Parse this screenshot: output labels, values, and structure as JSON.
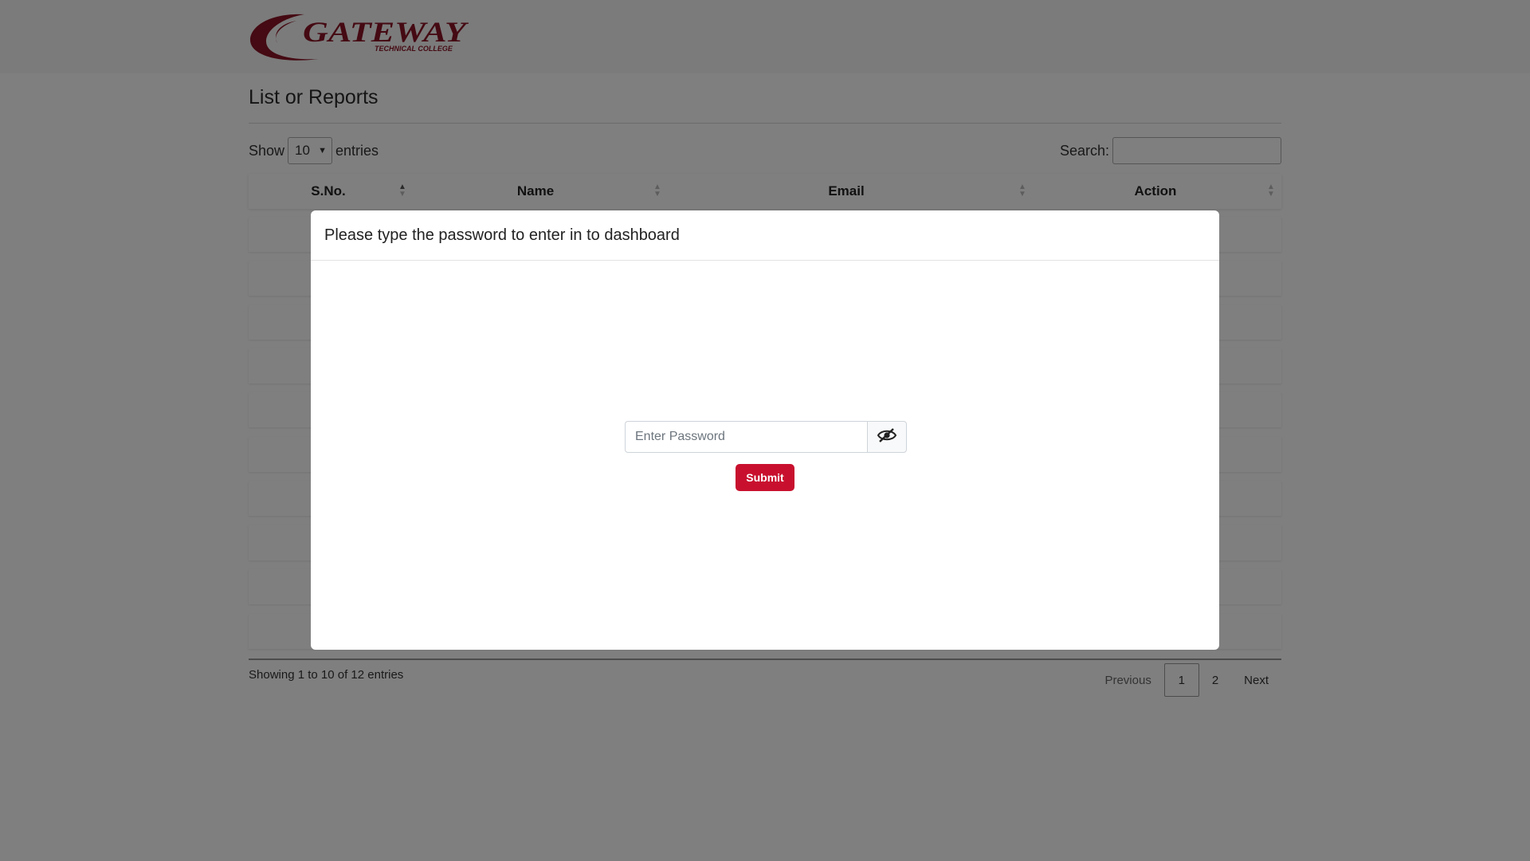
{
  "header": {
    "logo_main": "GATEWAY",
    "logo_sub": "TECHNICAL COLLEGE"
  },
  "page": {
    "title": "List or Reports"
  },
  "table_controls": {
    "show_label": "Show",
    "page_length": "10",
    "entries_label": "entries",
    "search_label": "Search:"
  },
  "table": {
    "columns": [
      "S.No.",
      "Name",
      "Email",
      "Action"
    ]
  },
  "footer": {
    "info": "Showing 1 to 10 of 12 entries",
    "previous": "Previous",
    "pages": [
      "1",
      "2"
    ],
    "current_page": "1",
    "next": "Next"
  },
  "modal": {
    "title": "Please type the password to enter in to dashboard",
    "password_placeholder": "Enter Password",
    "toggle_icon": "eye-slash-icon",
    "submit_label": "Submit"
  },
  "colors": {
    "brand": "#c8102e",
    "logo": "#8b1526"
  }
}
